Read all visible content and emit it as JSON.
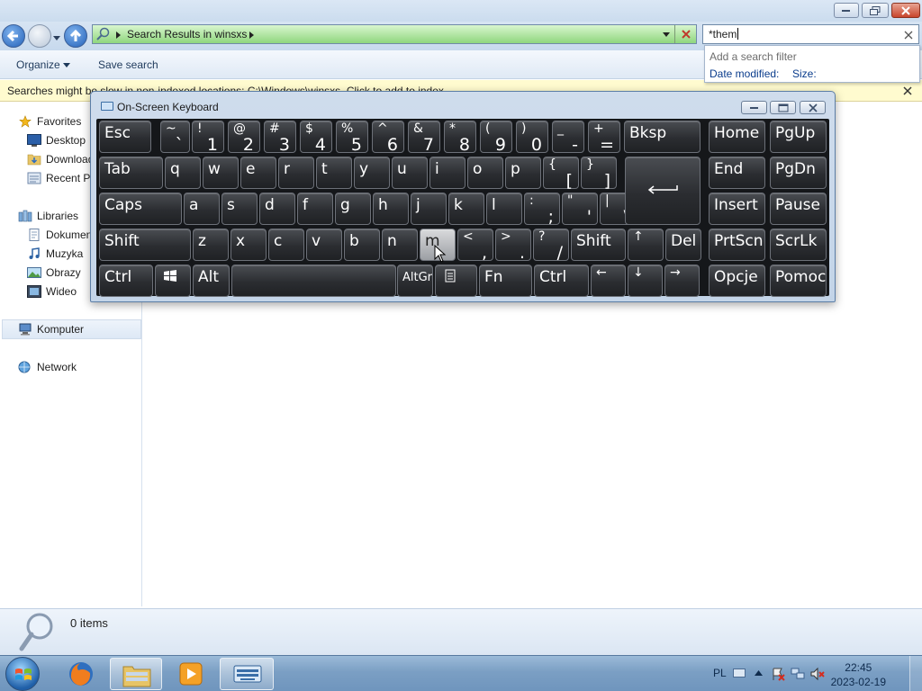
{
  "explorer": {
    "breadcrumb": "Search Results in winsxs",
    "search_value": "*them",
    "filter_dropdown": {
      "title": "Add a search filter",
      "options": [
        "Date modified:",
        "Size:"
      ]
    },
    "commands": [
      "Organize",
      "Save search"
    ],
    "infobar_text": "Searches might be slow in non-indexed locations: C:\\Windows\\winsxs. Click to add to index...",
    "nav": {
      "favorites": "Favorites",
      "desktop": "Desktop",
      "downloads": "Downloads",
      "recent": "Recent Places",
      "libraries": "Libraries",
      "documents": "Dokumenty",
      "music": "Muzyka",
      "pictures": "Obrazy",
      "videos": "Wideo",
      "computer": "Komputer",
      "network": "Network"
    },
    "status": "0 items"
  },
  "osk": {
    "title": "On-Screen Keyboard",
    "rows": [
      [
        {
          "w": "Esc"
        },
        {
          "u": "~",
          "l": "`"
        },
        {
          "u": "!",
          "l": "1"
        },
        {
          "u": "@",
          "l": "2"
        },
        {
          "u": "#",
          "l": "3"
        },
        {
          "u": "$",
          "l": "4"
        },
        {
          "u": "%",
          "l": "5"
        },
        {
          "u": "^",
          "l": "6"
        },
        {
          "u": "&",
          "l": "7"
        },
        {
          "u": "*",
          "l": "8"
        },
        {
          "u": "(",
          "l": "9"
        },
        {
          "u": ")",
          "l": "0"
        },
        {
          "u": "_",
          "l": "-"
        },
        {
          "u": "+",
          "l": "="
        },
        {
          "w": "Bksp"
        },
        {
          "w": "Home"
        },
        {
          "w": "PgUp"
        }
      ],
      [
        {
          "w": "Tab"
        },
        {
          "c": "q"
        },
        {
          "c": "w"
        },
        {
          "c": "e"
        },
        {
          "c": "r"
        },
        {
          "c": "t"
        },
        {
          "c": "y"
        },
        {
          "c": "u"
        },
        {
          "c": "i"
        },
        {
          "c": "o"
        },
        {
          "c": "p"
        },
        {
          "u": "{",
          "l": "["
        },
        {
          "u": "}",
          "l": "]"
        },
        {
          "w": "End"
        },
        {
          "w": "PgDn"
        }
      ],
      [
        {
          "w": "Caps"
        },
        {
          "c": "a"
        },
        {
          "c": "s"
        },
        {
          "c": "d"
        },
        {
          "c": "f"
        },
        {
          "c": "g"
        },
        {
          "c": "h"
        },
        {
          "c": "j"
        },
        {
          "c": "k"
        },
        {
          "c": "l"
        },
        {
          "u": ":",
          "l": ";"
        },
        {
          "u": "\"",
          "l": "'"
        },
        {
          "u": "|",
          "l": "\\"
        },
        {
          "w": "Insert"
        },
        {
          "w": "Pause"
        }
      ],
      [
        {
          "w": "Shift"
        },
        {
          "c": "z"
        },
        {
          "c": "x"
        },
        {
          "c": "c"
        },
        {
          "c": "v"
        },
        {
          "c": "b"
        },
        {
          "c": "n"
        },
        {
          "c": "m",
          "pressed": true
        },
        {
          "u": "<",
          "l": ","
        },
        {
          "u": ">",
          "l": "."
        },
        {
          "u": "?",
          "l": "/"
        },
        {
          "w": "Shift"
        },
        {
          "u": "↑"
        },
        {
          "w": "Del"
        },
        {
          "w": "PrtScn"
        },
        {
          "w": "ScrLk"
        }
      ],
      [
        {
          "w": "Ctrl"
        },
        {
          "icon": "windows-logo"
        },
        {
          "w": "Alt"
        },
        {
          "w": ""
        },
        {
          "w": "AltGr",
          "small": true
        },
        {
          "icon": "menu"
        },
        {
          "w": "Fn"
        },
        {
          "w": "Ctrl"
        },
        {
          "u": "←"
        },
        {
          "u": "↓"
        },
        {
          "u": "→"
        },
        {
          "w": "Opcje"
        },
        {
          "w": "Pomoc"
        }
      ]
    ]
  },
  "taskbar": {
    "language": "PL",
    "time": "22:45",
    "date": "2023-02-19"
  }
}
